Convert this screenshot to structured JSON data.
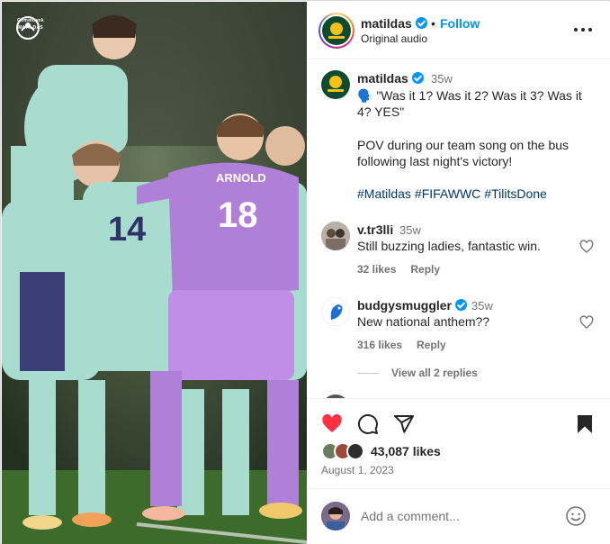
{
  "media": {
    "brand_text": "MATILDAS",
    "brand_sub": "Commbank",
    "jersey_name": "ARNOLD",
    "jersey_number": "18",
    "teammate_number": "14"
  },
  "header": {
    "username": "matildas",
    "separator": "•",
    "follow_label": "Follow",
    "subtitle": "Original audio"
  },
  "caption": {
    "username": "matildas",
    "time": "35w",
    "text_line1": "🗣️ \"Was it 1? Was it 2? Was it 3? Was it 4? YES\"",
    "text_line2": "POV during our team song on the bus following last night's victory!",
    "hashtags": [
      "#Matildas",
      "#FIFAWWC",
      "#TilitsDone"
    ]
  },
  "comments": [
    {
      "username": "v.tr3lli",
      "time": "35w",
      "text": "Still buzzing ladies, fantastic win.",
      "likes": "32 likes",
      "reply_label": "Reply",
      "verified": false
    },
    {
      "username": "budgysmuggler",
      "time": "35w",
      "text": "New national anthem??",
      "likes": "316 likes",
      "reply_label": "Reply",
      "verified": true
    }
  ],
  "view_replies_label": "View all 2 replies",
  "actions": {
    "likes_count": "43,087 likes",
    "date": "August 1, 2023",
    "liked": true
  },
  "add_comment": {
    "placeholder": "Add a comment..."
  },
  "colors": {
    "link_blue": "#0095f6",
    "hashtag": "#00376b",
    "like_red": "#ff3040",
    "jersey_purple": "#b07fd8",
    "kit_mint": "#a8dccf"
  },
  "icons": [
    "more-icon",
    "verified-icon",
    "heart-icon",
    "comment-icon",
    "share-icon",
    "bookmark-icon",
    "emoji-icon"
  ]
}
